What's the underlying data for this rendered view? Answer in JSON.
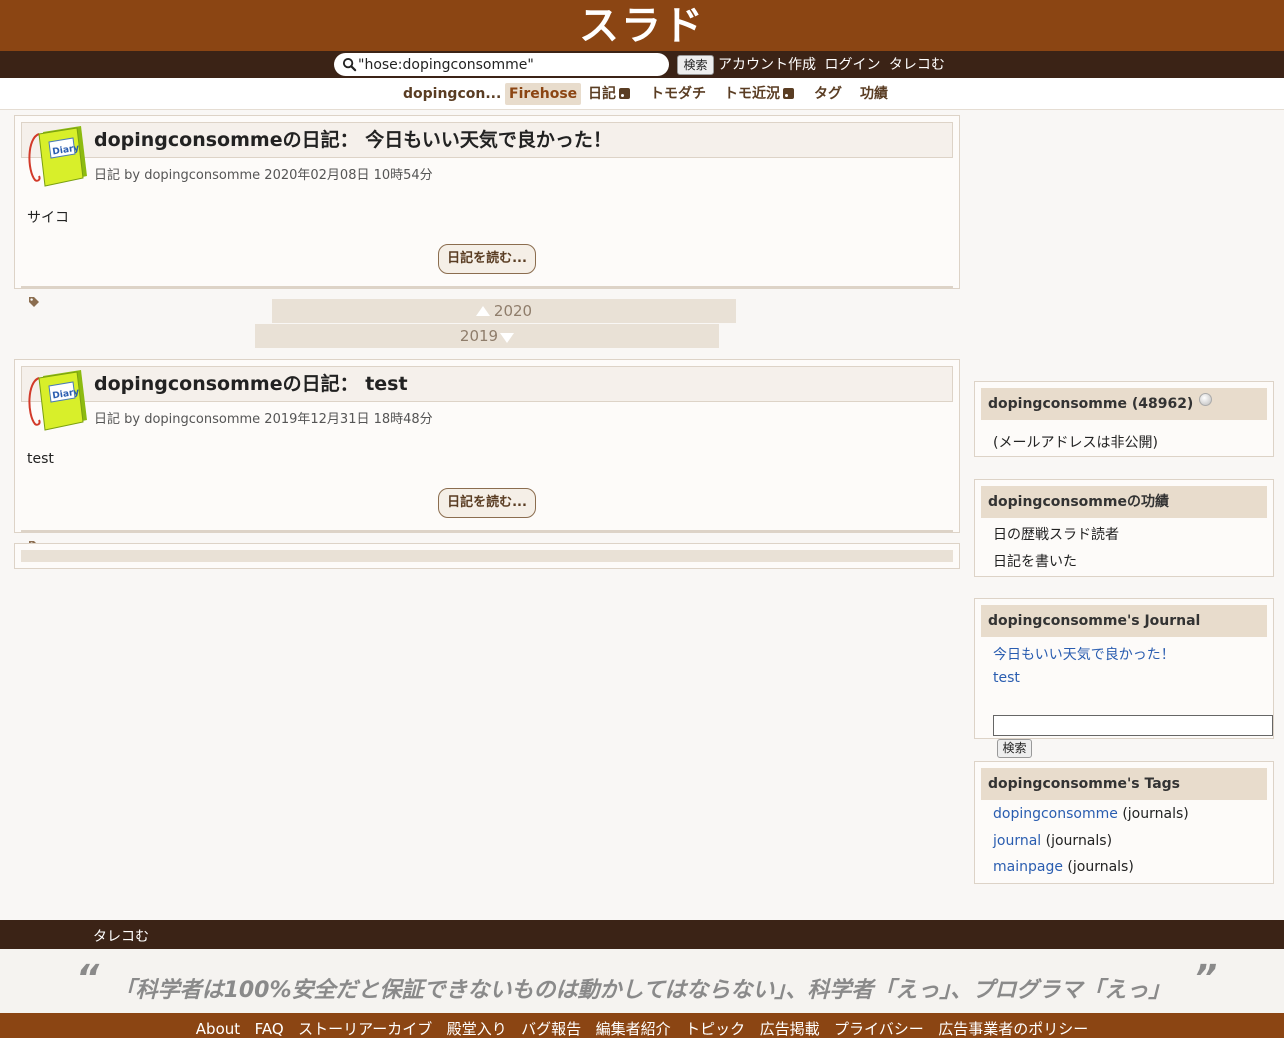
{
  "header": {
    "logo_text": "スラド",
    "search_value": "\"hose:dopingconsomme\"",
    "search_button": "検索",
    "links": [
      "アカウント作成",
      "ログイン",
      "タレコむ"
    ]
  },
  "nav": {
    "items": [
      {
        "label": "dopingcon..."
      },
      {
        "label": "Firehose"
      },
      {
        "label": "日記"
      },
      {
        "label": "トモダチ"
      },
      {
        "label": "トモ近況"
      },
      {
        "label": "タグ"
      },
      {
        "label": "功績"
      }
    ]
  },
  "articles": [
    {
      "title": "dopingconsommeの日記： 今日もいい天気で良かった！",
      "meta": "日記 by dopingconsomme 2020年02月08日 10時54分",
      "body": "サイコ",
      "read_more": "日記を読む..."
    },
    {
      "title": "dopingconsommeの日記： test",
      "meta": "日記 by dopingconsomme 2019年12月31日 18時48分",
      "body": "test",
      "read_more": "日記を読む..."
    }
  ],
  "pager": {
    "newer_year": "2020",
    "older_year": "2019"
  },
  "sidebar": {
    "user": {
      "title": "dopingconsomme (48962)",
      "email_note": "(メールアドレスは非公開)"
    },
    "achievements": {
      "title": "dopingconsommeの功績",
      "items": [
        "日の歴戦スラド読者",
        "日記を書いた"
      ]
    },
    "journal": {
      "title": "dopingconsomme's Journal",
      "items": [
        "今日もいい天気で良かった！",
        "test"
      ],
      "search_button": "検索"
    },
    "tags": {
      "title": "dopingconsomme's Tags",
      "items": [
        {
          "tag": "dopingconsomme",
          "suffix": " (journals)"
        },
        {
          "tag": "journal",
          "suffix": " (journals)"
        },
        {
          "tag": "mainpage",
          "suffix": " (journals)"
        }
      ]
    }
  },
  "footer": {
    "slogan": "タレコむ",
    "quote": "「科学者は100%安全だと保証できないものは動かしてはならない」、科学者「えっ」、プログラマ「えっ」",
    "open_quote": "“",
    "close_quote": "”",
    "links": [
      "About",
      "FAQ",
      "ストーリアーカイブ",
      "殿堂入り",
      "バグ報告",
      "編集者紹介",
      "トピック",
      "広告掲載",
      "プライバシー",
      "広告事業者のポリシー"
    ]
  },
  "colors": {
    "brand": "#8b4513",
    "dark": "#3b2316",
    "link": "#2a5db0"
  }
}
